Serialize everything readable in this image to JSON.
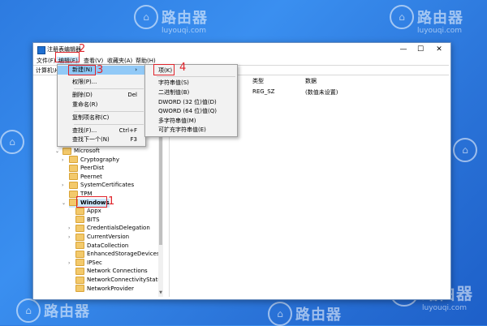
{
  "watermark": {
    "brand": "路由器",
    "domain": "luyouqi.com"
  },
  "window": {
    "title": "注册表编辑器",
    "controls": [
      "—",
      "☐",
      "✕"
    ],
    "menu": [
      "文件(F)",
      "编辑(E)",
      "查看(V)",
      "收藏夹(A)",
      "帮助(H)"
    ],
    "address": "计算机\\H"
  },
  "tree": [
    {
      "label": "Microsoft",
      "expander": "⌄",
      "bold": false
    },
    {
      "label": "Cryptography",
      "expander": "›",
      "bold": false
    },
    {
      "label": "PeerDist",
      "expander": "",
      "bold": false
    },
    {
      "label": "Peernet",
      "expander": "",
      "bold": false
    },
    {
      "label": "SystemCertificates",
      "expander": "›",
      "bold": false
    },
    {
      "label": "TPM",
      "expander": "",
      "bold": false
    },
    {
      "label": "Windows",
      "expander": "⌄",
      "bold": true
    },
    {
      "label": "Appx",
      "expander": "",
      "bold": false
    },
    {
      "label": "BITS",
      "expander": "",
      "bold": false
    },
    {
      "label": "CredentialsDelegation",
      "expander": "›",
      "bold": false
    },
    {
      "label": "CurrentVersion",
      "expander": "›",
      "bold": false
    },
    {
      "label": "DataCollection",
      "expander": "",
      "bold": false
    },
    {
      "label": "EnhancedStorageDevices",
      "expander": "",
      "bold": false
    },
    {
      "label": "IPSec",
      "expander": "›",
      "bold": false
    },
    {
      "label": "Network Connections",
      "expander": "",
      "bold": false
    },
    {
      "label": "NetworkConnectivityStatusI",
      "expander": "",
      "bold": false
    },
    {
      "label": "NetworkProvider",
      "expander": "",
      "bold": false
    }
  ],
  "values_pane": {
    "col_type": "类型",
    "col_data": "数据",
    "row_type": "REG_SZ",
    "row_data": "(数值未设置)"
  },
  "edit_menu": [
    {
      "label": "新建(N)",
      "shortcut": "›"
    },
    {
      "label": "权限(P)...",
      "shortcut": ""
    },
    {
      "label": "删除(D)",
      "shortcut": "Del"
    },
    {
      "label": "重命名(R)",
      "shortcut": ""
    },
    {
      "label": "复制项名称(C)",
      "shortcut": ""
    },
    {
      "label": "查找(F)...",
      "shortcut": "Ctrl+F"
    },
    {
      "label": "查找下一个(N)",
      "shortcut": "F3"
    }
  ],
  "new_submenu": [
    "项(K)",
    "字符串值(S)",
    "二进制值(B)",
    "DWORD (32 位)值(D)",
    "QWORD (64 位)值(Q)",
    "多字符串值(M)",
    "可扩充字符串值(E)"
  ],
  "step_markers": [
    "1",
    "2",
    "3",
    "4"
  ],
  "colors": {
    "highlight": "#91c9f7",
    "annotation_red": "#e0242b",
    "desktop": "#2d7be0"
  }
}
